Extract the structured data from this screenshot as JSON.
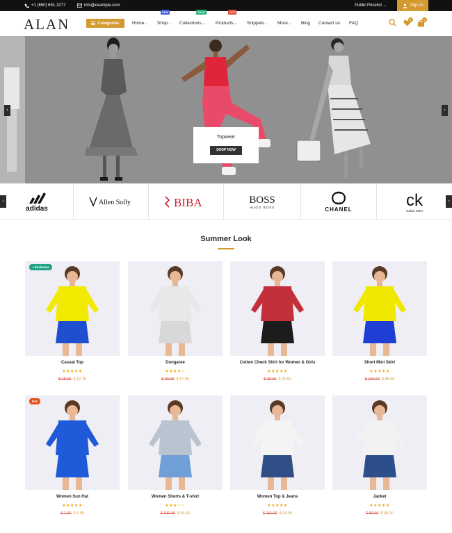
{
  "topbar": {
    "phone": "+1 (650) 691-3277",
    "email": "info@example.com",
    "pricelist": "Public Pricelist",
    "signin": "Sign in"
  },
  "header": {
    "logo": "ALAN",
    "categories": "Categories",
    "nav": [
      {
        "label": "Home",
        "dropdown": true
      },
      {
        "label": "Shop",
        "dropdown": true,
        "badge": "NEW",
        "badge_color": "#3d5bd9"
      },
      {
        "label": "Collections",
        "dropdown": true,
        "badge": "SALE",
        "badge_color": "#27b07a"
      },
      {
        "label": "Products",
        "dropdown": true,
        "badge": "HOT",
        "badge_color": "#e04a3a"
      },
      {
        "label": "Snippets",
        "dropdown": true
      },
      {
        "label": "More",
        "dropdown": true
      },
      {
        "label": "Blog",
        "dropdown": false
      },
      {
        "label": "Contact us",
        "dropdown": false
      },
      {
        "label": "FAQ",
        "dropdown": false
      }
    ],
    "wishlist_count": "0",
    "cart_count": "0"
  },
  "hero": {
    "title": "Topwear",
    "button": "SHOP NOW"
  },
  "brands": [
    {
      "name": "adidas",
      "icon": "adidas-logo"
    },
    {
      "name": "Allen Solly",
      "icon": "allen-solly-logo"
    },
    {
      "name": "BIBA",
      "icon": "biba-logo"
    },
    {
      "name": "BOSS",
      "sub": "HUGO BOSS",
      "icon": "boss-logo"
    },
    {
      "name": "CHANEL",
      "icon": "chanel-logo"
    },
    {
      "name": "ck",
      "sub": "Calvin Klein",
      "icon": "ck-logo"
    }
  ],
  "section": {
    "title": "Summer Look"
  },
  "products": [
    {
      "name": "Casual Top",
      "old_price": "$ 15.00",
      "price": "$ 12.75",
      "stars": "★★★★★",
      "tag": "+ Exclusive",
      "tag_color": "#1fa386",
      "top": "#f2ea00",
      "bottom": "#1f4fcf"
    },
    {
      "name": "Dungaree",
      "old_price": "$ 20.00",
      "price": "$ 17.00",
      "stars": "★★★★☆",
      "tag": "",
      "top": "#e8e8e8",
      "bottom": "#d8d8d8"
    },
    {
      "name": "Cotton Check Shirt for Women & Girls",
      "old_price": "$ 30.00",
      "price": "$ 25.50",
      "stars": "★★★★★",
      "tag": "",
      "top": "#c4303a",
      "bottom": "#1c1c1c"
    },
    {
      "name": "Short Mini Skirt",
      "old_price": "$ 100.00",
      "price": "$ 85.00",
      "stars": "★★★★★",
      "tag": "",
      "top": "#f0e800",
      "bottom": "#1f3fd4"
    },
    {
      "name": "Women Sun Hat",
      "old_price": "$ 7.00",
      "price": "$ 5.95",
      "stars": "★★★★★",
      "tag": "Hot",
      "tag_color": "#e8521e",
      "top": "#1f5ad8",
      "bottom": "#1f5ad8"
    },
    {
      "name": "Women Shorts & T-shirt",
      "old_price": "$ 100.00",
      "price": "$ 85.00",
      "stars": "★★★☆☆",
      "tag": "",
      "top": "#b9c4d0",
      "bottom": "#6f9fd6"
    },
    {
      "name": "Women Top & Jeans",
      "old_price": "$ 111.00",
      "price": "$ 94.35",
      "stars": "★★★★★",
      "tag": "",
      "top": "#f4f4f4",
      "bottom": "#2f4f86"
    },
    {
      "name": "Jacket",
      "old_price": "$ 80.00",
      "price": "$ 68.00",
      "stars": "★★★★★",
      "tag": "",
      "top": "#f2f2f2",
      "bottom": "#2c4f8c"
    }
  ],
  "colors": {
    "accent": "#d39a2f",
    "old_price": "#e04a3a",
    "stars": "#f0a500"
  }
}
